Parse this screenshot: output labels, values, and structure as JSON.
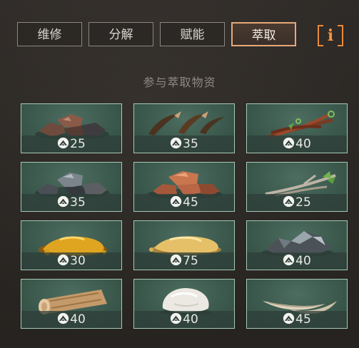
{
  "tabs": [
    "维修",
    "分解",
    "赋能",
    "萃取"
  ],
  "active_tab": "萃取",
  "info_button": {
    "glyph": "i",
    "icon": "info-icon",
    "color": "#f0953e"
  },
  "section_title": "参与萃取物资",
  "items": [
    {
      "name": "ore-rocks-red",
      "count": "25"
    },
    {
      "name": "claws",
      "count": "35"
    },
    {
      "name": "herb-stalks",
      "count": "40"
    },
    {
      "name": "ore-rocks-grey",
      "count": "35"
    },
    {
      "name": "copper-nuggets",
      "count": "45"
    },
    {
      "name": "twigs",
      "count": "25"
    },
    {
      "name": "amber-resin",
      "count": "30"
    },
    {
      "name": "gold-resin",
      "count": "75"
    },
    {
      "name": "crystal-ore",
      "count": "40"
    },
    {
      "name": "wood-log",
      "count": "40"
    },
    {
      "name": "white-fat",
      "count": "40"
    },
    {
      "name": "fangs",
      "count": "45"
    }
  ],
  "count_icon": "mountain-currency-icon"
}
